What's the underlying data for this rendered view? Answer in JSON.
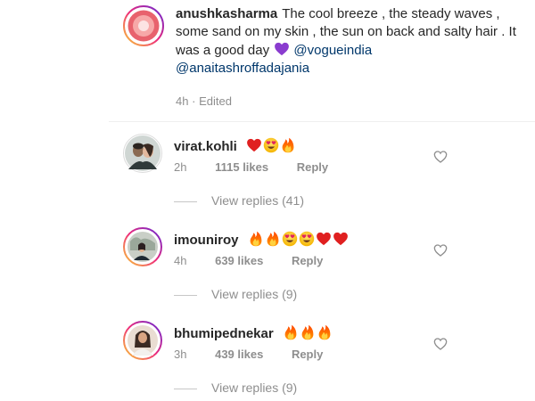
{
  "caption": {
    "username": "anushkasharma",
    "text": "The cool breeze , the steady waves , some sand on my skin , the sun on back and salty hair . It was a good day",
    "emoji": "purple-heart",
    "mentions": [
      "@vogueindia",
      "@anaitashroffadajania"
    ],
    "time": "4h",
    "edited": "Edited",
    "separator": "·"
  },
  "comments": [
    {
      "username": "virat.kohli",
      "emojis": [
        "red-heart",
        "heart-eyes",
        "fire"
      ],
      "time": "2h",
      "likes": "1115 likes",
      "reply": "Reply",
      "view_replies": "View replies (41)"
    },
    {
      "username": "imouniroy",
      "emojis": [
        "fire",
        "fire",
        "heart-eyes",
        "heart-eyes",
        "red-heart",
        "red-heart"
      ],
      "time": "4h",
      "likes": "639 likes",
      "reply": "Reply",
      "view_replies": "View replies (9)"
    },
    {
      "username": "bhumipednekar",
      "emojis": [
        "fire",
        "fire",
        "fire"
      ],
      "time": "3h",
      "likes": "439 likes",
      "reply": "Reply",
      "view_replies": "View replies (9)"
    }
  ],
  "colors": {
    "text": "#262626",
    "secondary": "#8e8e8e",
    "mention": "#00376b",
    "story_ring_start": "#f9ce34",
    "story_ring_mid": "#ee2a7b",
    "story_ring_end": "#6228d7"
  }
}
